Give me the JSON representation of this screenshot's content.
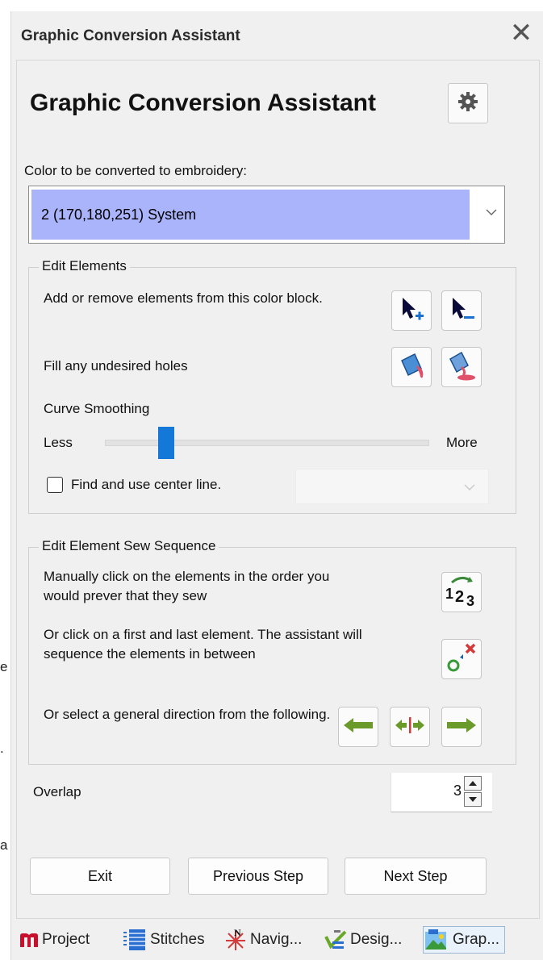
{
  "window": {
    "title": "Graphic Conversion Assistant",
    "close_glyph": "✕"
  },
  "edge_fragments": [
    "e",
    ".",
    "a"
  ],
  "heading": "Graphic Conversion Assistant",
  "color_section": {
    "label": "Color to be converted to embroidery:",
    "selected": "2    (170,180,251) System",
    "highlight_color": "#aab4fb"
  },
  "edit_elements": {
    "legend": "Edit Elements",
    "add_remove_text": "Add or remove elements from this color block.",
    "fill_holes_text": "Fill any undesired holes",
    "curve_smoothing_label": "Curve Smoothing",
    "less_label": "Less",
    "more_label": "More",
    "smoothing_level": 0.19,
    "center_line_label": "Find and use center line.",
    "center_line_checked": false
  },
  "sew_sequence": {
    "legend": "Edit Element Sew Sequence",
    "manual_text": "Manually click on the elements in the order you would prever that they sew",
    "first_last_text": "Or click on a first and last element. The assistant will sequence the elements in between",
    "direction_text": "Or select a general direction from the following."
  },
  "overlap": {
    "label": "Overlap",
    "value": "3"
  },
  "buttons": {
    "exit": "Exit",
    "previous": "Previous Step",
    "next": "Next Step"
  },
  "tabs": [
    {
      "label": "Project",
      "icon": "m-logo-icon"
    },
    {
      "label": "Stitches",
      "icon": "stitches-icon"
    },
    {
      "label": "Navig...",
      "icon": "compass-icon"
    },
    {
      "label": "Desig...",
      "icon": "design-icon"
    },
    {
      "label": "Grap...",
      "icon": "graphic-icon",
      "active": true
    }
  ],
  "accent_color": "#1478d8"
}
